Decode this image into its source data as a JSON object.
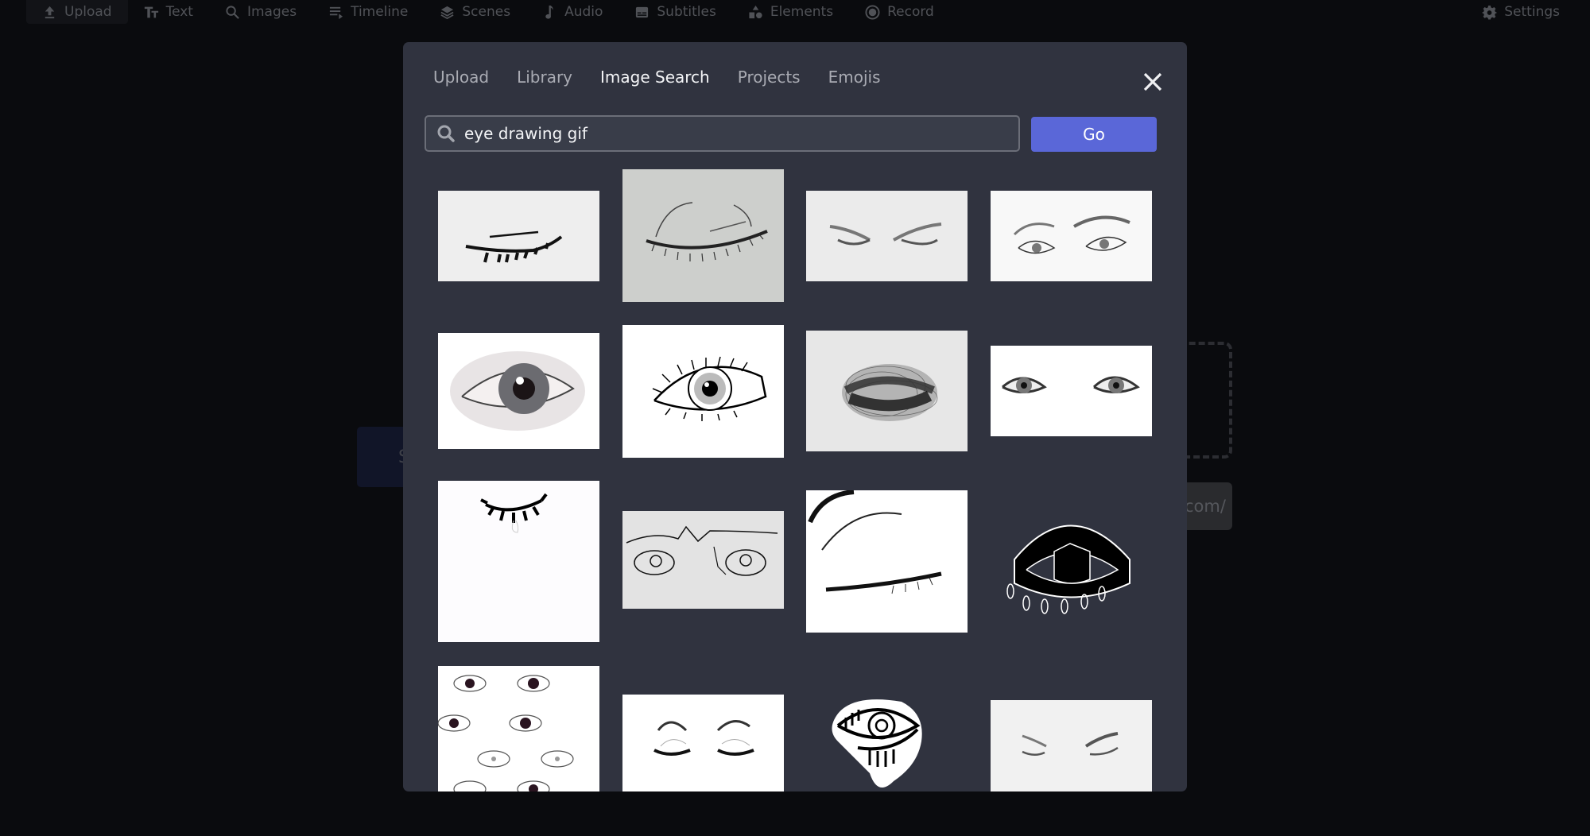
{
  "topnav": {
    "items": [
      {
        "label": "Upload",
        "icon": "upload-icon",
        "active": true
      },
      {
        "label": "Text",
        "icon": "text-icon"
      },
      {
        "label": "Images",
        "icon": "search-icon"
      },
      {
        "label": "Timeline",
        "icon": "timeline-icon"
      },
      {
        "label": "Scenes",
        "icon": "layers-icon"
      },
      {
        "label": "Audio",
        "icon": "music-note-icon"
      },
      {
        "label": "Subtitles",
        "icon": "subtitles-icon"
      },
      {
        "label": "Elements",
        "icon": "shapes-icon"
      },
      {
        "label": "Record",
        "icon": "record-icon"
      }
    ],
    "settings": {
      "label": "Settings",
      "icon": "gear-icon"
    }
  },
  "background": {
    "button_fragment": "S",
    "url_fragment": "com/"
  },
  "modal": {
    "tabs": [
      {
        "label": "Upload"
      },
      {
        "label": "Library"
      },
      {
        "label": "Image Search",
        "active": true
      },
      {
        "label": "Projects"
      },
      {
        "label": "Emojis"
      }
    ],
    "close_icon": "close-icon",
    "search": {
      "value": "eye drawing gif",
      "icon": "search-icon"
    },
    "go_label": "Go",
    "results": [
      {
        "description": "closed eye ink sketch with lashes"
      },
      {
        "description": "closed eye pencil sketch on gray paper"
      },
      {
        "description": "pair of winged eyes faint sketch"
      },
      {
        "description": "pair of eyes with eyebrows sketch"
      },
      {
        "description": "realistic shaded eye painting"
      },
      {
        "description": "line art open eye with lashes"
      },
      {
        "description": "scribbled closed eye"
      },
      {
        "description": "pair of realistic eyes"
      },
      {
        "description": "crying closed eye with tear"
      },
      {
        "description": "continuous line eyes and brows"
      },
      {
        "description": "closed eye with brow line art"
      },
      {
        "description": "bold graphic eye with tears"
      },
      {
        "description": "eye pattern wallpaper"
      },
      {
        "description": "pair of closed eyes with brows"
      },
      {
        "description": "spiral eye sticker"
      },
      {
        "description": "pair of closed winged eyes"
      }
    ]
  },
  "colors": {
    "accent": "#5a67d8",
    "modal_bg": "#30333f",
    "page_bg": "#0a0b0e"
  }
}
